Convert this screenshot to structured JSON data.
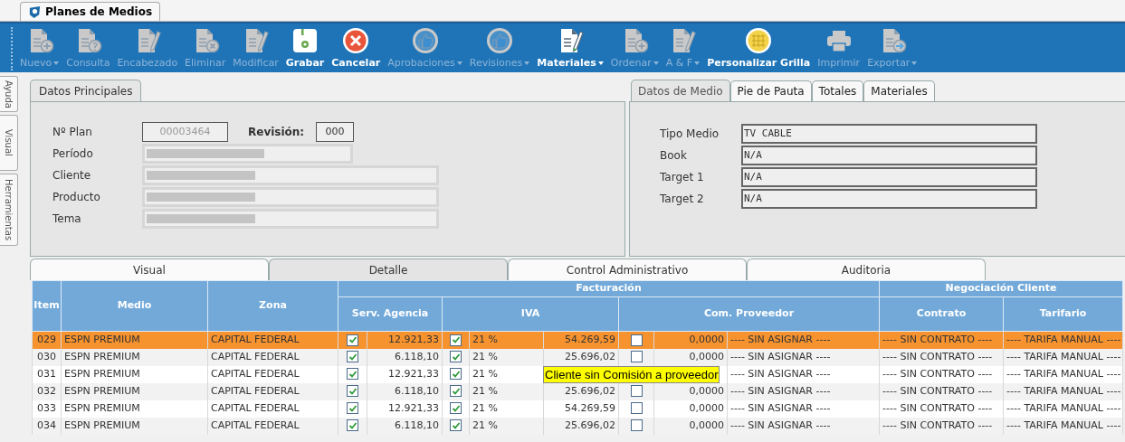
{
  "window": {
    "tab": "Planes de Medios"
  },
  "toolbar": [
    {
      "label": "Nuevo",
      "kind": "doc-plus",
      "disabled": true,
      "dropdown": true
    },
    {
      "label": "Consulta",
      "kind": "doc-question",
      "disabled": true,
      "dropdown": false
    },
    {
      "label": "Encabezado",
      "kind": "doc-pencil",
      "disabled": true,
      "dropdown": false
    },
    {
      "label": "Eliminar",
      "kind": "doc-x",
      "disabled": true,
      "dropdown": false
    },
    {
      "label": "Modificar",
      "kind": "doc-pencil",
      "disabled": true,
      "dropdown": false
    },
    {
      "label": "Grabar",
      "kind": "save",
      "disabled": false,
      "dropdown": false
    },
    {
      "label": "Cancelar",
      "kind": "cancel",
      "disabled": false,
      "dropdown": false
    },
    {
      "label": "Aprobaciones",
      "kind": "thumb",
      "disabled": true,
      "dropdown": true
    },
    {
      "label": "Revisiones",
      "kind": "thumb",
      "disabled": true,
      "dropdown": true
    },
    {
      "label": "Materiales",
      "kind": "doc-pencil",
      "disabled": false,
      "dropdown": true
    },
    {
      "label": "Ordenar",
      "kind": "doc-plus",
      "disabled": true,
      "dropdown": true
    },
    {
      "label": "A & F",
      "kind": "doc-pencil",
      "disabled": true,
      "dropdown": true
    },
    {
      "label": "Personalizar Grilla",
      "kind": "grid",
      "disabled": false,
      "dropdown": false
    },
    {
      "label": "Imprimir",
      "kind": "printer",
      "disabled": true,
      "dropdown": false
    },
    {
      "label": "Exportar",
      "kind": "doc-arrow",
      "disabled": true,
      "dropdown": true
    }
  ],
  "side_tabs": [
    "Ayuda",
    "Visual",
    "Herramientas"
  ],
  "main_panel": {
    "tab": "Datos Principales",
    "plan_label": "Nº Plan",
    "plan_value": "00003464",
    "revision_label": "Revisión:",
    "revision_value": "000",
    "fields": [
      {
        "label": "Período",
        "kind": "short"
      },
      {
        "label": "Cliente",
        "kind": "long"
      },
      {
        "label": "Producto",
        "kind": "long"
      },
      {
        "label": "Tema",
        "kind": "long"
      }
    ]
  },
  "media_panel": {
    "tabs": [
      {
        "label": "Datos de Medio",
        "selected": true
      },
      {
        "label": "Pie de Pauta",
        "selected": false
      },
      {
        "label": "Totales",
        "selected": false
      },
      {
        "label": "Materiales",
        "selected": false
      }
    ],
    "fields": [
      {
        "label": "Tipo Medio",
        "value": "TV CABLE"
      },
      {
        "label": "Book",
        "value": "N/A"
      },
      {
        "label": "Target 1",
        "value": "N/A"
      },
      {
        "label": "Target 2",
        "value": "N/A"
      }
    ]
  },
  "detail_tabs": [
    {
      "label": "Visual",
      "selected": false
    },
    {
      "label": "Detalle",
      "selected": true
    },
    {
      "label": "Control Administrativo",
      "selected": false
    },
    {
      "label": "Auditoria",
      "selected": false
    }
  ],
  "table": {
    "columns": [
      "Item",
      "Medio",
      "Zona"
    ],
    "group_1": "Facturación",
    "group_2": "Negociación Cliente",
    "subcolumns": [
      "Serv. Agencia",
      "IVA",
      "Com. Proveedor",
      "Contrato",
      "Tarifario"
    ],
    "rows": [
      {
        "selected": true,
        "item": "029",
        "medio": "ESPN PREMIUM",
        "zona": "CAPITAL FEDERAL",
        "serv_checked": true,
        "serv": "12.921,33",
        "iva_checked": true,
        "iva_rate": "21 %",
        "iva": "54.269,59",
        "com_checked": false,
        "com": "0,0000",
        "proveedor": "---- SIN ASIGNAR ----",
        "contrato": "---- SIN CONTRATO ----",
        "tarifario": "---- TARIFA MANUAL ----"
      },
      {
        "selected": false,
        "item": "030",
        "medio": "ESPN PREMIUM",
        "zona": "CAPITAL FEDERAL",
        "serv_checked": true,
        "serv": "6.118,10",
        "iva_checked": true,
        "iva_rate": "21 %",
        "iva": "25.696,02",
        "com_checked": false,
        "com": "0,0000",
        "proveedor": "---- SIN ASIGNAR ----",
        "contrato": "---- SIN CONTRATO ----",
        "tarifario": "---- TARIFA MANUAL ----"
      },
      {
        "selected": false,
        "item": "031",
        "medio": "ESPN PREMIUM",
        "zona": "CAPITAL FEDERAL",
        "serv_checked": true,
        "serv": "12.921,33",
        "iva_checked": true,
        "iva_rate": "21 %",
        "proveedor": "---- SIN ASIGNAR ----",
        "contrato": "---- SIN CONTRATO ----",
        "tarifario": "---- TARIFA MANUAL ----"
      },
      {
        "selected": false,
        "item": "032",
        "medio": "ESPN PREMIUM",
        "zona": "CAPITAL FEDERAL",
        "serv_checked": true,
        "serv": "6.118,10",
        "iva_checked": true,
        "iva_rate": "21 %",
        "iva": "25.696,02",
        "com_checked": false,
        "com": "0,0000",
        "proveedor": "---- SIN ASIGNAR ----",
        "contrato": "---- SIN CONTRATO ----",
        "tarifario": "---- TARIFA MANUAL ----"
      },
      {
        "selected": false,
        "item": "033",
        "medio": "ESPN PREMIUM",
        "zona": "CAPITAL FEDERAL",
        "serv_checked": true,
        "serv": "12.921,33",
        "iva_checked": true,
        "iva_rate": "21 %",
        "iva": "54.269,59",
        "com_checked": false,
        "com": "0,0000",
        "proveedor": "---- SIN ASIGNAR ----",
        "contrato": "---- SIN CONTRATO ----",
        "tarifario": "---- TARIFA MANUAL ----"
      },
      {
        "selected": false,
        "item": "034",
        "medio": "ESPN PREMIUM",
        "zona": "CAPITAL FEDERAL",
        "serv_checked": true,
        "serv": "6.118,10",
        "iva_checked": true,
        "iva_rate": "21 %",
        "iva": "25.696,02",
        "com_checked": false,
        "com": "0,0000",
        "proveedor": "---- SIN ASIGNAR ----",
        "contrato": "---- SIN CONTRATO ----",
        "tarifario": "---- TARIFA MANUAL ----"
      }
    ]
  },
  "tooltip": "Cliente sin Comisión a proveedor"
}
